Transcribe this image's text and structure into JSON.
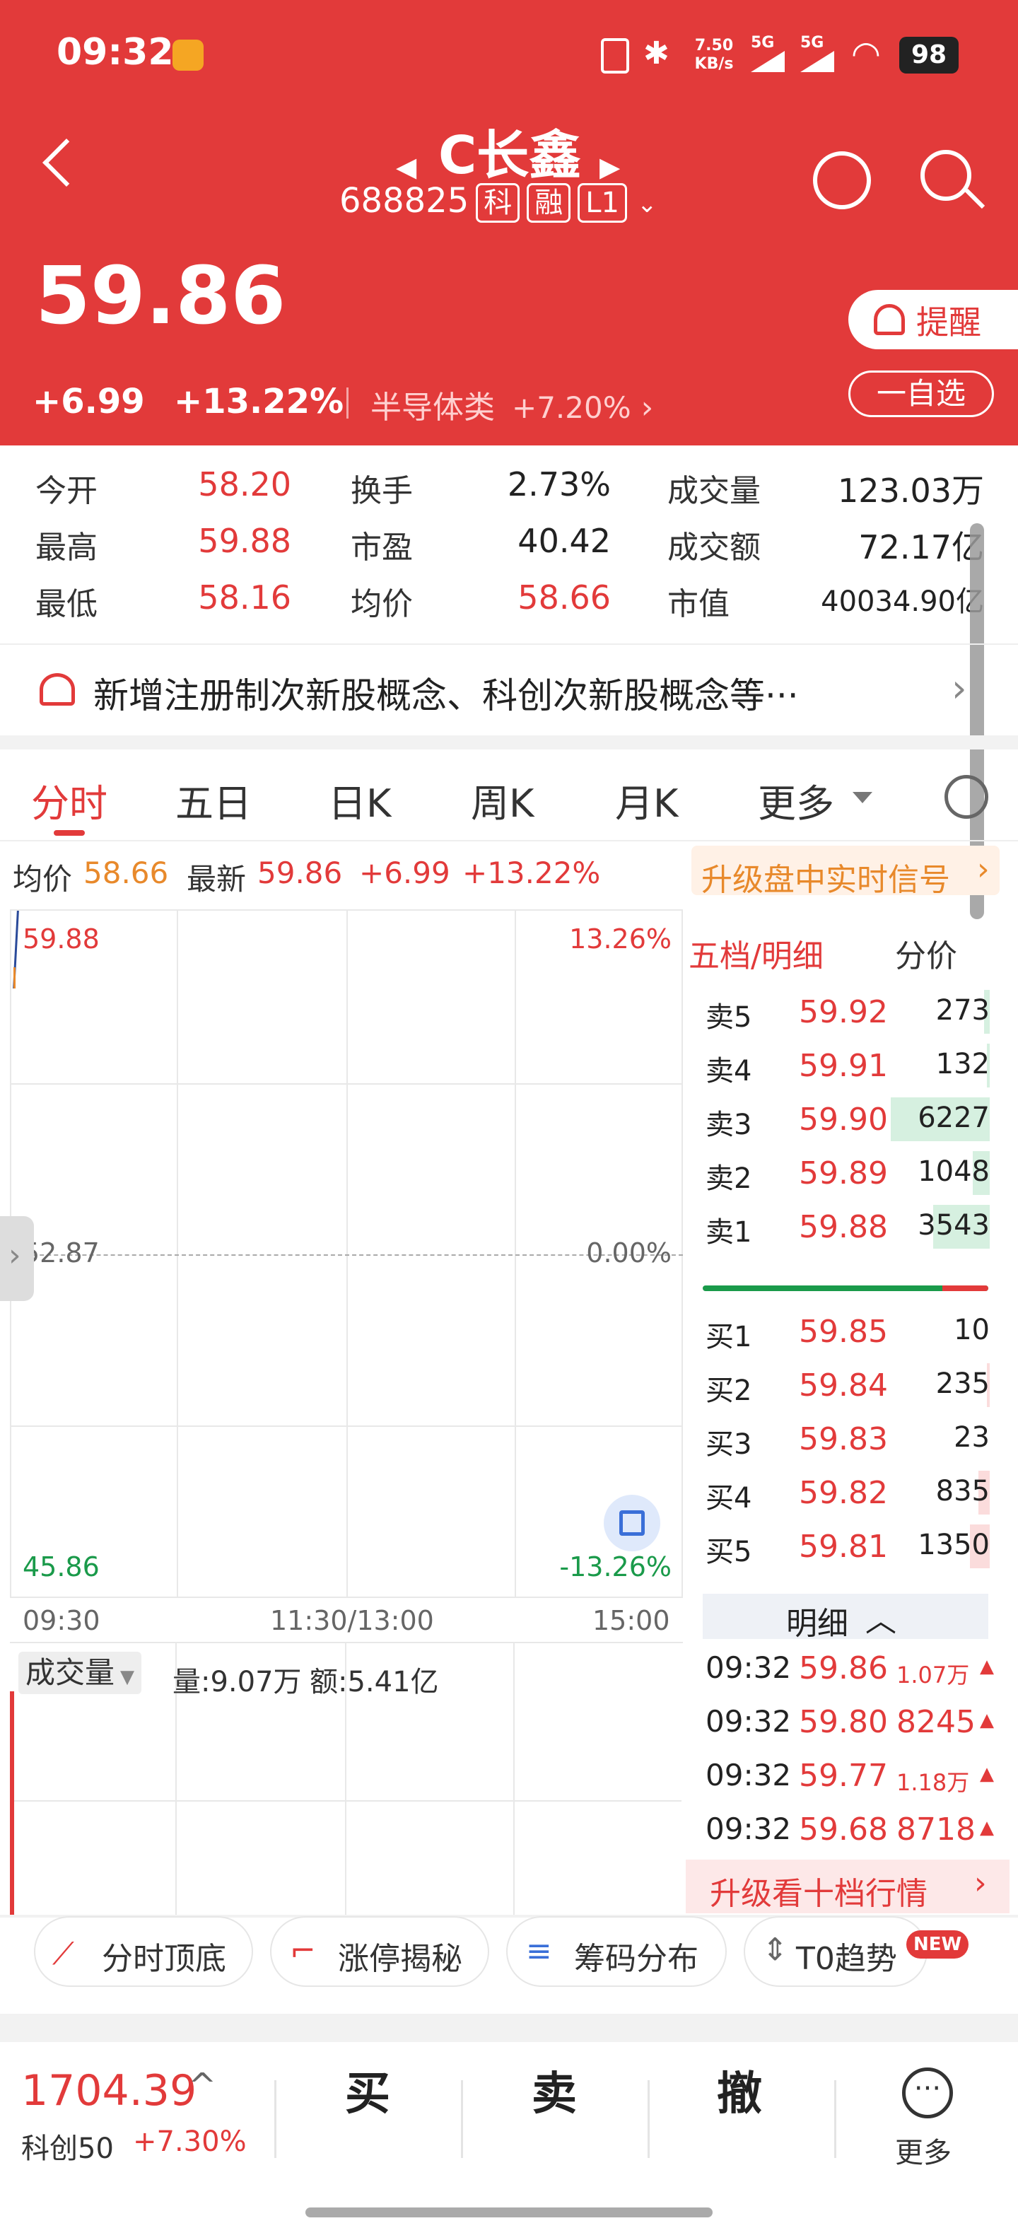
{
  "status_bar": {
    "time": "09:32",
    "net_speed": "7.50 KB/s",
    "signal_1": "5G",
    "signal_2": "5G",
    "battery": "98"
  },
  "header": {
    "title": "C长鑫",
    "code": "688825",
    "tags": [
      "科",
      "融",
      "L1"
    ],
    "price": "59.86",
    "change": "+6.99",
    "change_pct": "+13.22%",
    "sector": "半导体类",
    "sector_pct": "+7.20%",
    "alert_button": "提醒",
    "watch_button": "一自选"
  },
  "quote": {
    "rows": [
      [
        {
          "label": "今开",
          "value": "58.20",
          "color": "red"
        },
        {
          "label": "换手",
          "value": "2.73%",
          "color": "dark"
        },
        {
          "label": "成交量",
          "value": "123.03万",
          "color": "dark"
        }
      ],
      [
        {
          "label": "最高",
          "value": "59.88",
          "color": "red"
        },
        {
          "label": "市盈",
          "value": "40.42",
          "color": "dark"
        },
        {
          "label": "成交额",
          "value": "72.17亿",
          "color": "dark"
        }
      ],
      [
        {
          "label": "最低",
          "value": "58.16",
          "color": "red"
        },
        {
          "label": "均价",
          "value": "58.66",
          "color": "red"
        },
        {
          "label": "市值",
          "value": "40034.90亿",
          "color": "dark"
        }
      ]
    ]
  },
  "news": {
    "text": "新增注册制次新股概念、科创次新股概念等···"
  },
  "tabs": [
    "分时",
    "五日",
    "日K",
    "周K",
    "月K",
    "更多"
  ],
  "chart_header": {
    "avg_label": "均价",
    "avg": "58.66",
    "latest_label": "最新",
    "latest": "59.86",
    "change": "+6.99",
    "change_pct": "+13.22%",
    "upgrade": "升级盘中实时信号"
  },
  "chart_axis": {
    "high": "59.88",
    "high_pct": "13.26%",
    "mid": "52.87",
    "mid_pct": "0.00%",
    "low": "45.86",
    "low_pct": "-13.26%",
    "time_start": "09:30",
    "time_mid": "11:30/13:00",
    "time_end": "15:00"
  },
  "volume": {
    "label": "成交量",
    "vol": "量:9.07万",
    "amt": "额:5.41亿"
  },
  "order_book": {
    "title": "五档/明细",
    "subtitle": "分价",
    "asks": [
      {
        "label": "卖5",
        "price": "59.92",
        "vol": "273",
        "fill": 0.02
      },
      {
        "label": "卖4",
        "price": "59.91",
        "vol": "132",
        "fill": 0.01
      },
      {
        "label": "卖3",
        "price": "59.90",
        "vol": "6227",
        "fill": 0.35
      },
      {
        "label": "卖2",
        "price": "59.89",
        "vol": "1048",
        "fill": 0.06
      },
      {
        "label": "卖1",
        "price": "59.88",
        "vol": "3543",
        "fill": 0.2
      }
    ],
    "bids": [
      {
        "label": "买1",
        "price": "59.85",
        "vol": "10",
        "fill": 0.0
      },
      {
        "label": "买2",
        "price": "59.84",
        "vol": "235",
        "fill": 0.01
      },
      {
        "label": "买3",
        "price": "59.83",
        "vol": "23",
        "fill": 0.0
      },
      {
        "label": "买4",
        "price": "59.82",
        "vol": "835",
        "fill": 0.04
      },
      {
        "label": "买5",
        "price": "59.81",
        "vol": "1350",
        "fill": 0.07
      }
    ],
    "buy_sell_ratio": 0.84,
    "detail_label": "明细",
    "ticks": [
      {
        "time": "09:32",
        "price": "59.86",
        "vol": "1.07万"
      },
      {
        "time": "09:32",
        "price": "59.80",
        "vol": "8245"
      },
      {
        "time": "09:32",
        "price": "59.77",
        "vol": "1.18万"
      },
      {
        "time": "09:32",
        "price": "59.68",
        "vol": "8718"
      }
    ],
    "upgrade": "升级看十档行情"
  },
  "tools": [
    "分时顶底",
    "涨停揭秘",
    "筹码分布",
    "T0趋势"
  ],
  "tools_new_badge": "NEW",
  "bottom": {
    "index_value": "1704.39",
    "index_name": "科创50",
    "index_pct": "+7.30%",
    "buy": "买",
    "sell": "卖",
    "cancel": "撤",
    "more": "更多"
  },
  "colors": {
    "brand_red": "#e23a3a",
    "green": "#1a9a4a",
    "orange": "#e8892b"
  },
  "icons": [
    "back-icon",
    "left-arrow-icon",
    "right-arrow-icon",
    "refresh-icon",
    "search-icon",
    "bell-icon",
    "chevron-right-icon",
    "settings-icon",
    "expand-icon",
    "chevron-up-icon",
    "more-icon"
  ]
}
